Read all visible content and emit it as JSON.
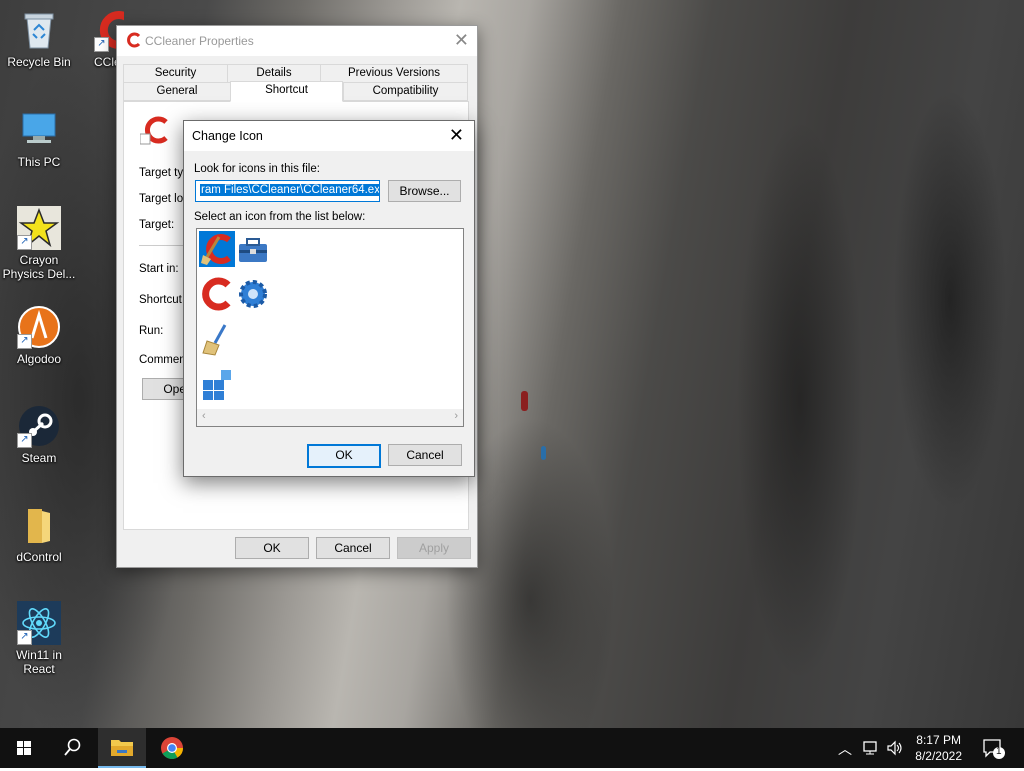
{
  "desktop": {
    "icons": [
      {
        "label": "Recycle Bin",
        "icon": "recycle-bin-icon"
      },
      {
        "label": "CCle",
        "icon": "ccleaner-icon"
      },
      {
        "label": "This PC",
        "icon": "computer-icon"
      },
      {
        "label": "Crayon Physics Del...",
        "label_line1": "Crayon",
        "label_line2": "Physics Del...",
        "icon": "crayon-physics-icon"
      },
      {
        "label": "Algodoo",
        "icon": "algodoo-icon"
      },
      {
        "label": "Steam",
        "icon": "steam-icon"
      },
      {
        "label": "dControl",
        "icon": "folder-icon"
      },
      {
        "label": "Win11 in React",
        "label_line1": "Win11 in",
        "label_line2": "React",
        "icon": "react-icon"
      }
    ]
  },
  "properties_window": {
    "title": "CCleaner Properties",
    "tabs_row1": [
      "Security",
      "Details",
      "Previous Versions"
    ],
    "tabs_row2": [
      "General",
      "Shortcut",
      "Compatibility"
    ],
    "active_tab": "Shortcut",
    "fields": [
      "Target typ",
      "Target loc",
      "Target:",
      "Start in:",
      "Shortcut k",
      "Run:",
      "Comment:"
    ],
    "open_button": "Open",
    "buttons": {
      "ok": "OK",
      "cancel": "Cancel",
      "apply": "Apply"
    }
  },
  "change_icon_dialog": {
    "title": "Change Icon",
    "look_for_label": "Look for icons in this file:",
    "file_path": "ram Files\\CCleaner\\CCleaner64.exe",
    "browse_button": "Browse...",
    "select_label": "Select an icon from the list below:",
    "icons": [
      "ccleaner-broom-icon",
      "toolbox-icon",
      "ccleaner-c-icon",
      "gear-icon",
      "broom-icon",
      "windows-tiles-icon"
    ],
    "selected_index": 0,
    "buttons": {
      "ok": "OK",
      "cancel": "Cancel"
    }
  },
  "taskbar": {
    "time": "8:17 PM",
    "date": "8/2/2022",
    "notification_count": "1",
    "items": [
      "start-icon",
      "search-icon",
      "file-explorer-icon",
      "chrome-icon"
    ]
  },
  "colors": {
    "accent": "#0078d7",
    "taskbar": "#111111"
  }
}
